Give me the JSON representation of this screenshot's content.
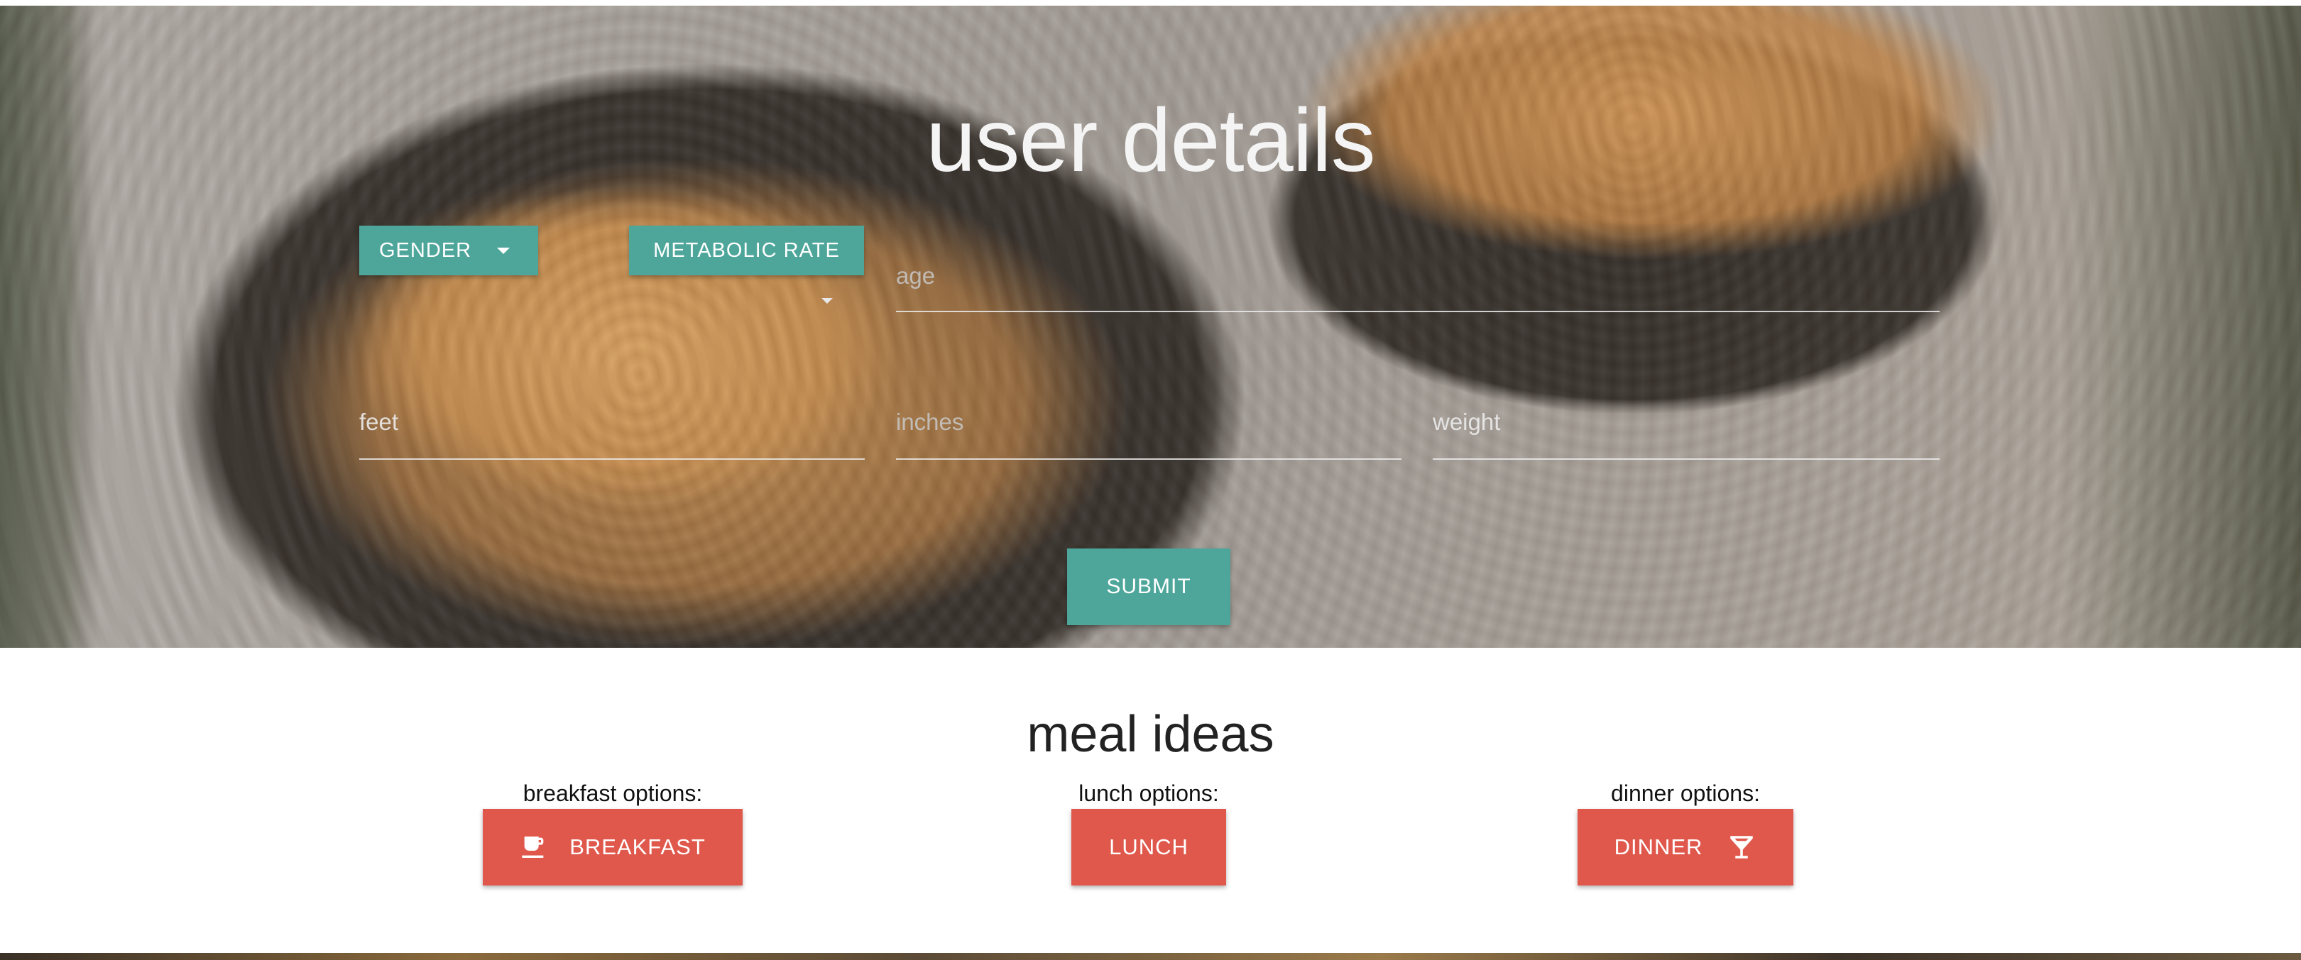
{
  "hero": {
    "title": "user details",
    "gender_label": "GENDER",
    "metabolic_label": "METABOLIC RATE",
    "age_placeholder": "age",
    "feet_placeholder": "feet",
    "inches_placeholder": "inches",
    "weight_placeholder": "weight",
    "submit_label": "SUBMIT"
  },
  "meals": {
    "title": "meal ideas",
    "breakfast": {
      "label": "breakfast options:",
      "button": "BREAKFAST",
      "icon": "coffee-cup-icon"
    },
    "lunch": {
      "label": "lunch options:",
      "button": "LUNCH"
    },
    "dinner": {
      "label": "dinner options:",
      "button": "DINNER",
      "icon": "cocktail-glass-icon"
    }
  },
  "colors": {
    "teal": "#4ea69b",
    "red": "#e0584c"
  }
}
